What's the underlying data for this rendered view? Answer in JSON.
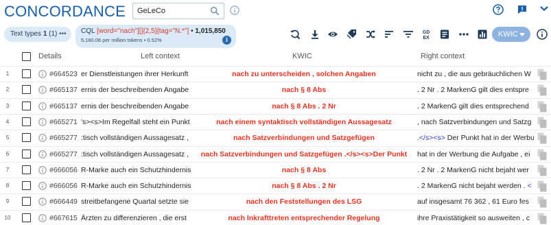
{
  "app": {
    "title": "CONCORDANCE",
    "corpus_value": "GeLeCo"
  },
  "filters": {
    "text_types_label": "Text types",
    "text_types_count": "1",
    "text_types_paren": "(1)",
    "more_glyph": "•••"
  },
  "query": {
    "prefix": "CQL",
    "cql": "[word=\"nach\"][]{2,5}[tag=\"N.*\"]",
    "bullet": "•",
    "hits": "1,015,850",
    "per_million": "5,180.06 per million tokens • 0.52%"
  },
  "view": {
    "mode_label": "KWIC"
  },
  "table": {
    "headers": {
      "details": "Details",
      "left": "Left context",
      "kwic": "KWIC",
      "right": "Right context"
    },
    "rows": [
      {
        "n": "1",
        "doc": "#664523",
        "left": "er Dienstleistungen ihrer Herkunft",
        "kwic": "nach zu unterscheiden , solchen Angaben",
        "right": "nicht zu , die aus gebräuchlichen W",
        "right_tag": ""
      },
      {
        "n": "2",
        "doc": "#665137",
        "left": "ernis der beschreibenden Angabe",
        "kwic": "nach § 8 Abs",
        "right": ". 2 Nr . 2 MarkenG gilt dies entspre",
        "right_tag": ""
      },
      {
        "n": "3",
        "doc": "#665137",
        "left": "ernis der beschreibenden Angabe",
        "kwic": "nach § 8 Abs . 2 Nr",
        "right": ". 2 MarkenG gilt dies entsprechend",
        "right_tag": ""
      },
      {
        "n": "4",
        "doc": "#665271",
        "left": "'s><s>Im Regelfall steht ein Punkt",
        "kwic": "nach einem syntaktisch vollständigen Aussagesatz",
        "right": ", nach Satzverbindungen und Satzg",
        "right_tag": ""
      },
      {
        "n": "5",
        "doc": "#665277",
        "left": ":tisch vollständigen Aussagesatz ,",
        "kwic": "nach Satzverbindungen und Satzgefügen",
        "right": " Der Punkt hat in der Werbu",
        "right_tag": ".</s><s>"
      },
      {
        "n": "6",
        "doc": "#665277",
        "left": ":tisch vollständigen Aussagesatz ,",
        "kwic": "nach Satzverbindungen und Satzgefügen .</s><s>Der Punkt",
        "right": "hat in der Werbung die Aufgabe , ei",
        "right_tag": ""
      },
      {
        "n": "7",
        "doc": "#666056",
        "left": "R-Marke auch ein Schutzhindernis",
        "kwic": "nach § 8 Abs",
        "right": ". 2 Nr . 2 MarkenG nicht bejaht wer",
        "right_tag": ""
      },
      {
        "n": "8",
        "doc": "#666056",
        "left": "R-Marke auch ein Schutzhindernis",
        "kwic": "nach § 8 Abs . 2 Nr",
        "right": ". 2 MarkenG nicht bejaht werden .",
        "right_tag": "<"
      },
      {
        "n": "9",
        "doc": "#666449",
        "left": "streitbefangene Quartal setzte sie",
        "kwic": "nach den Feststellungen des LSG",
        "right": "auf insgesamt 76 362 , 61 Euro fes",
        "right_tag": ""
      },
      {
        "n": "10",
        "doc": "#667615",
        "left": "Ärzten zu differenzieren , die erst",
        "kwic": "nach Inkrafttreten entsprechender Regelung",
        "right": "ihre Praxistätigkeit so ausweiten , c",
        "right_tag": ""
      }
    ]
  },
  "colors": {
    "brand": "#1a5fa8",
    "kwic": "#e03322",
    "chip_bg": "#dceaf7",
    "toggle_bg": "#8db4e0"
  }
}
